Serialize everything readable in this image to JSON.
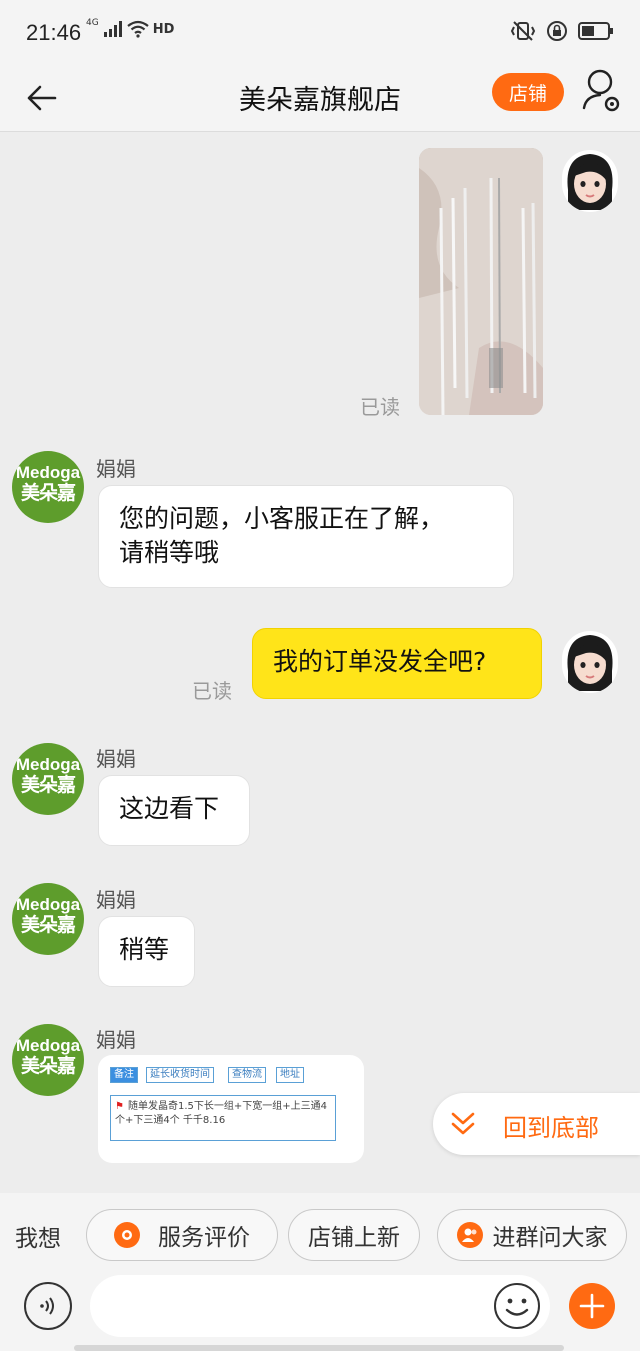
{
  "status_bar": {
    "time": "21:46",
    "signal_tag": "4G",
    "hd_tag": "HD",
    "icons": [
      "signal-icon",
      "wifi-icon",
      "hd-icon",
      "vibrate-icon",
      "lock-rotation-icon",
      "battery-icon"
    ]
  },
  "header": {
    "title": "美朵嘉旗舰店",
    "store_button": "店铺",
    "icons": [
      "back-arrow-icon",
      "profile-settings-icon"
    ]
  },
  "messages": [
    {
      "type": "image",
      "from": "me",
      "read": "已读"
    },
    {
      "type": "text",
      "from": "shop",
      "sender": "娟娟",
      "text_line1": "您的问题，小客服正在了解，",
      "text_line2": "请稍等哦"
    },
    {
      "type": "text",
      "from": "me",
      "text": "我的订单没发全吧?",
      "read": "已读"
    },
    {
      "type": "text",
      "from": "shop",
      "sender": "娟娟",
      "text": "这边看下"
    },
    {
      "type": "text",
      "from": "shop",
      "sender": "娟娟",
      "text": "稍等"
    },
    {
      "type": "card",
      "from": "shop",
      "sender": "娟娟"
    }
  ],
  "shop_avatar": {
    "en": "Medoga",
    "cn": "美朵嘉"
  },
  "order_card": {
    "tags": [
      "备注",
      "延长收货时间",
      "查物流",
      "地址"
    ],
    "note": "随单发晶奇1.5下长一组+下宽一组+上三通4个+下三通4个 千千8.16"
  },
  "back_to_bottom": "回到底部",
  "quick_actions": {
    "label": "我想",
    "items": [
      "服务评价",
      "店铺上新",
      "进群问大家"
    ]
  },
  "input": {
    "placeholder": "",
    "value": ""
  },
  "colors": {
    "accent": "#ff6a12",
    "my_bubble": "#ffe419",
    "shop_green": "#5e9d2c",
    "background": "#ededed"
  }
}
